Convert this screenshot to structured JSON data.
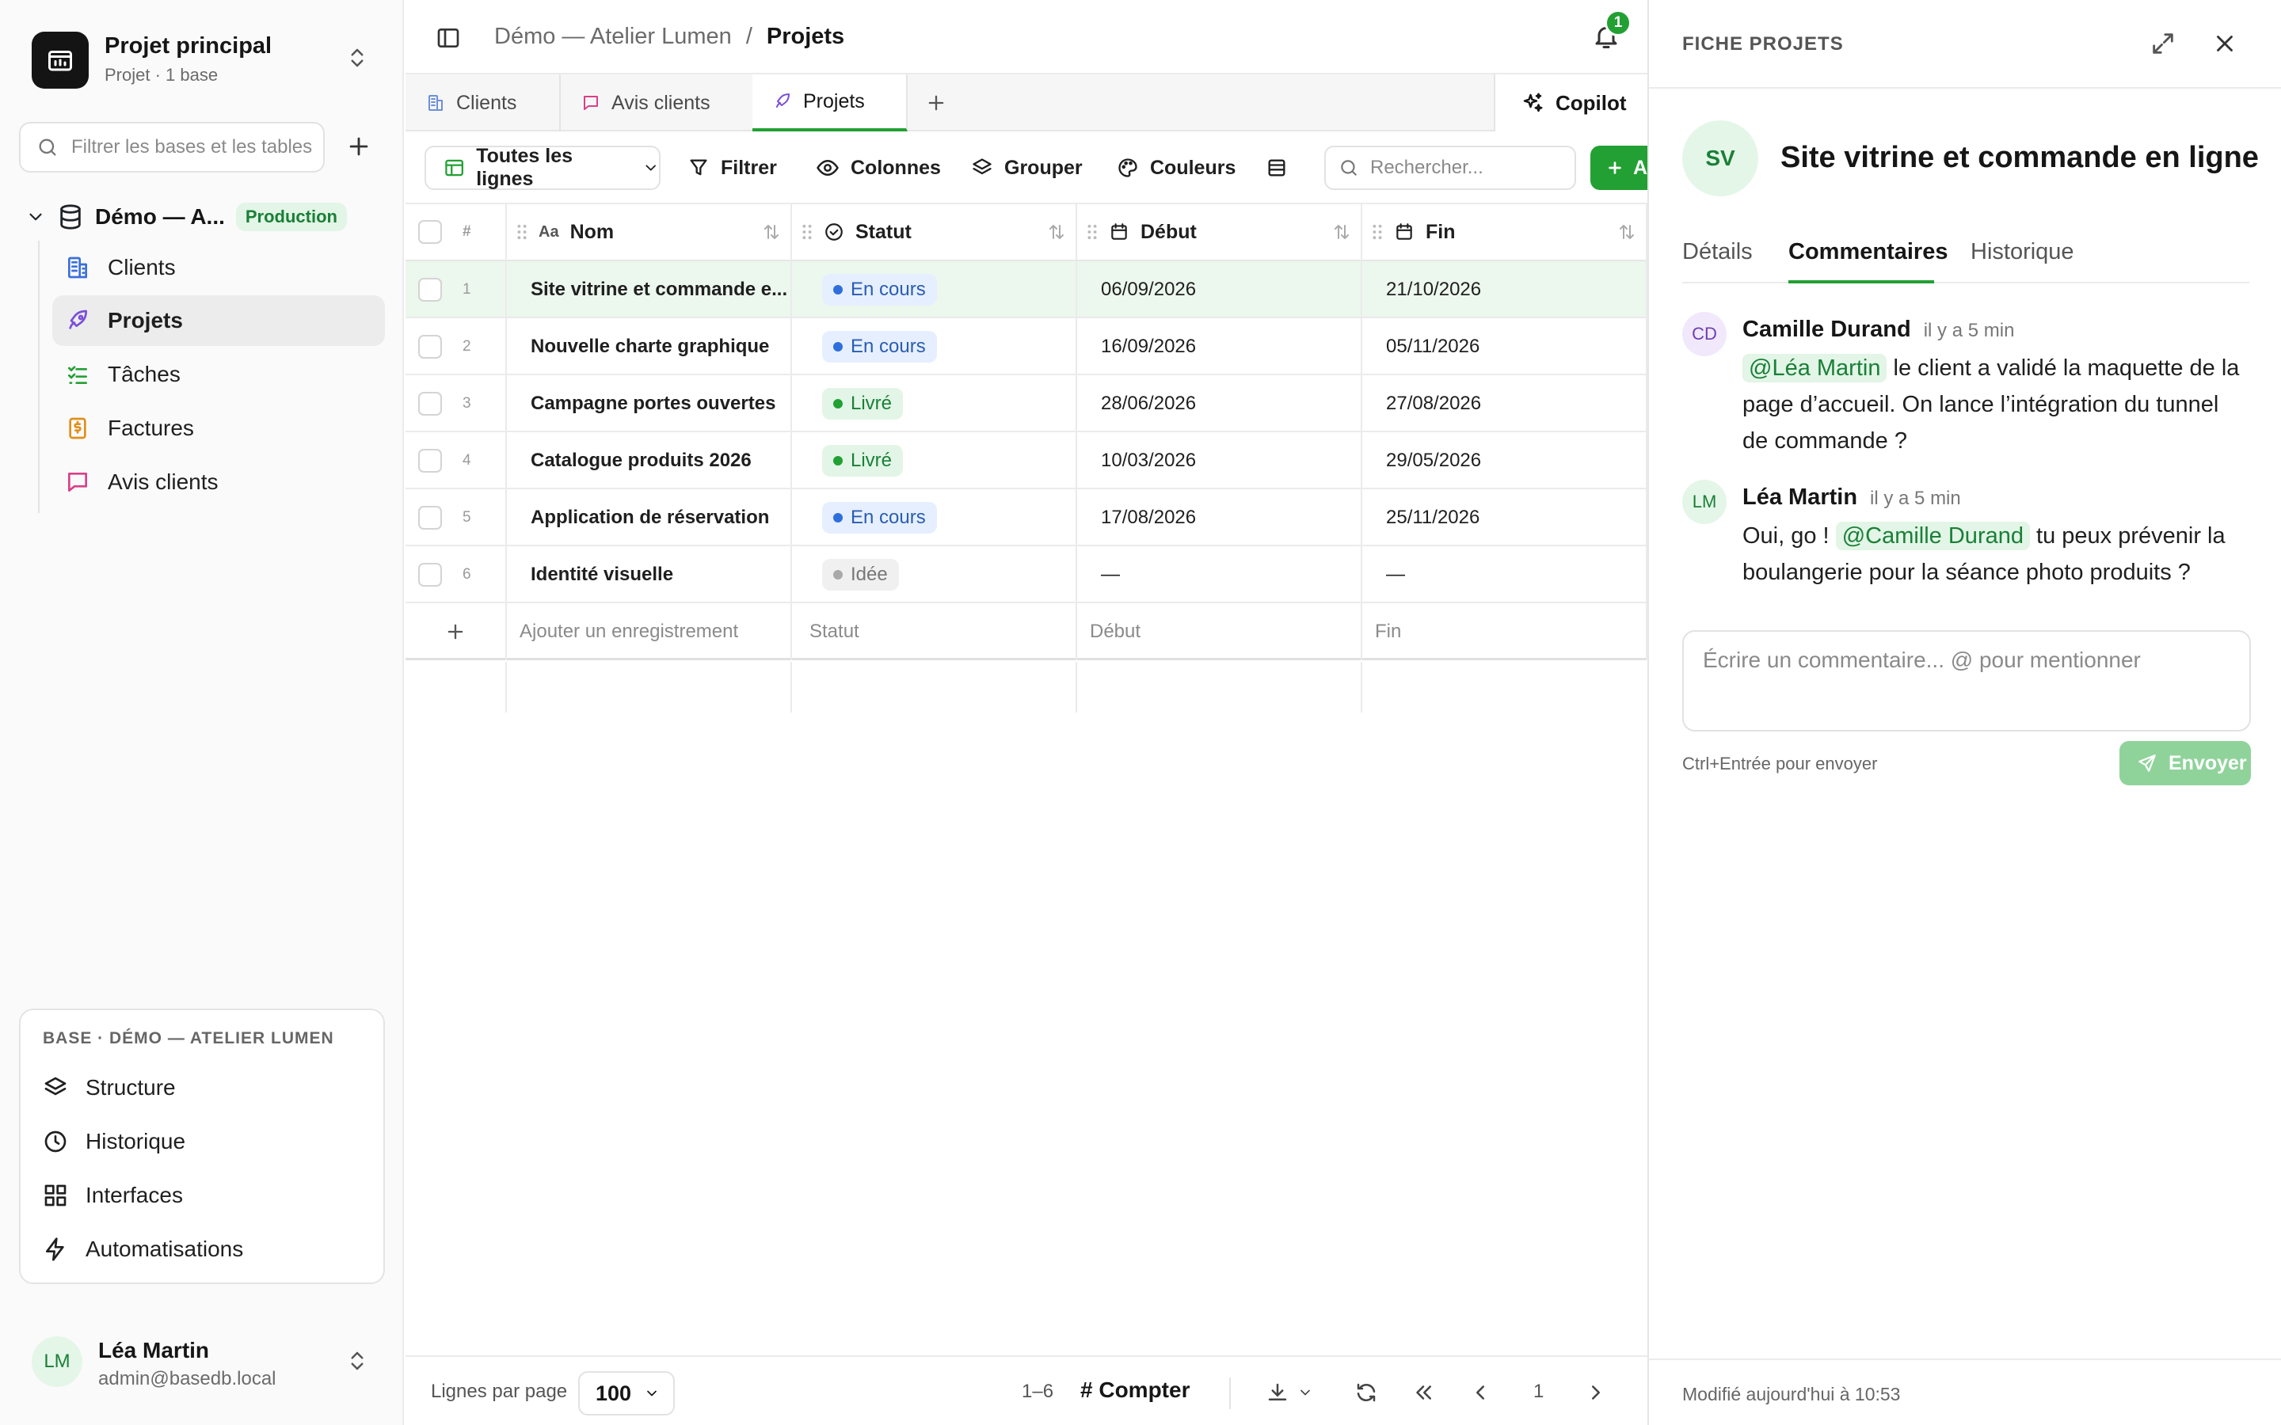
{
  "sidebar": {
    "project_title": "Projet principal",
    "project_subtitle": "Projet · 1 base",
    "search_placeholder": "Filtrer les bases et les tables",
    "database": {
      "name": "Démo — A...",
      "badge": "Production"
    },
    "items": [
      {
        "label": "Clients",
        "icon": "building-icon"
      },
      {
        "label": "Projets",
        "icon": "rocket-icon",
        "active": true
      },
      {
        "label": "Tâches",
        "icon": "checklist-icon"
      },
      {
        "label": "Factures",
        "icon": "invoice-icon"
      },
      {
        "label": "Avis clients",
        "icon": "message-icon"
      }
    ],
    "base_card": {
      "title": "BASE · DÉMO — ATELIER LUMEN",
      "items": [
        {
          "label": "Structure",
          "icon": "layers-icon"
        },
        {
          "label": "Historique",
          "icon": "clock-icon"
        },
        {
          "label": "Interfaces",
          "icon": "grid-icon"
        },
        {
          "label": "Automatisations",
          "icon": "bolt-icon"
        }
      ]
    },
    "user": {
      "initials": "LM",
      "name": "Léa Martin",
      "email": "admin@basedb.local"
    }
  },
  "main": {
    "breadcrumb": {
      "base": "Démo — Atelier Lumen",
      "separator": "/",
      "table": "Projets"
    },
    "notifications": {
      "count": "1"
    },
    "tabs": [
      {
        "label": "Clients",
        "icon": "building-icon"
      },
      {
        "label": "Avis clients",
        "icon": "message-icon"
      },
      {
        "label": "Projets",
        "icon": "rocket-icon",
        "active": true
      }
    ],
    "copilot_label": "Copilot",
    "toolbar": {
      "view_label": "Toutes les lignes",
      "filter_label": "Filtrer",
      "columns_label": "Colonnes",
      "group_label": "Grouper",
      "colors_label": "Couleurs",
      "search_placeholder": "Rechercher...",
      "add_label": "A"
    },
    "table": {
      "columns": [
        "#",
        "Nom",
        "Statut",
        "Début",
        "Fin"
      ],
      "rows": [
        {
          "n": "1",
          "nom": "Site vitrine et commande e...",
          "statut": "En cours",
          "statut_color": "blue",
          "debut": "06/09/2026",
          "fin": "21/10/2026",
          "selected": true
        },
        {
          "n": "2",
          "nom": "Nouvelle charte graphique",
          "statut": "En cours",
          "statut_color": "blue",
          "debut": "16/09/2026",
          "fin": "05/11/2026"
        },
        {
          "n": "3",
          "nom": "Campagne portes ouvertes",
          "statut": "Livré",
          "statut_color": "green",
          "debut": "28/06/2026",
          "fin": "27/08/2026"
        },
        {
          "n": "4",
          "nom": "Catalogue produits 2026",
          "statut": "Livré",
          "statut_color": "green",
          "debut": "10/03/2026",
          "fin": "29/05/2026"
        },
        {
          "n": "5",
          "nom": "Application de réservation",
          "statut": "En cours",
          "statut_color": "blue",
          "debut": "17/08/2026",
          "fin": "25/11/2026"
        },
        {
          "n": "6",
          "nom": "Identité visuelle",
          "statut": "Idée",
          "statut_color": "gray",
          "debut": "—",
          "fin": "—"
        }
      ],
      "new_row": {
        "nom": "Ajouter un enregistrement",
        "statut": "Statut",
        "debut": "Début",
        "fin": "Fin"
      }
    },
    "footer": {
      "rows_per_page_label": "Lignes par page",
      "rows_per_page": "100",
      "range": "1–6",
      "count_label": "# Compter",
      "page": "1"
    }
  },
  "panel": {
    "title": "FICHE PROJETS",
    "record_initials": "SV",
    "record_name": "Site vitrine et commande en ligne",
    "tabs": [
      "Détails",
      "Commentaires",
      "Historique"
    ],
    "active_tab": "Commentaires",
    "comments": [
      {
        "initials": "CD",
        "author": "Camille Durand",
        "time": "il y a 5 min",
        "mention": "@Léa Martin",
        "text": "le client a validé la maquette de la page d’accueil. On lance l’intégration du tunnel de commande ?"
      },
      {
        "initials": "LM",
        "author": "Léa Martin",
        "time": "il y a 5 min",
        "text_before": "Oui, go !",
        "mention": "@Camille Durand",
        "text": "tu peux prévenir la boulangerie pour la séance photo produits ?"
      }
    ],
    "input_placeholder": "Écrire un commentaire... @ pour mentionner",
    "hint": "Ctrl+Entrée pour envoyer",
    "send_label": "Envoyer",
    "footer": "Modifié aujourd'hui à 10:53"
  },
  "colors": {
    "accent": "#22a033",
    "accent_light": "#e2f5e6",
    "selected_row": "#ecf7ee"
  }
}
